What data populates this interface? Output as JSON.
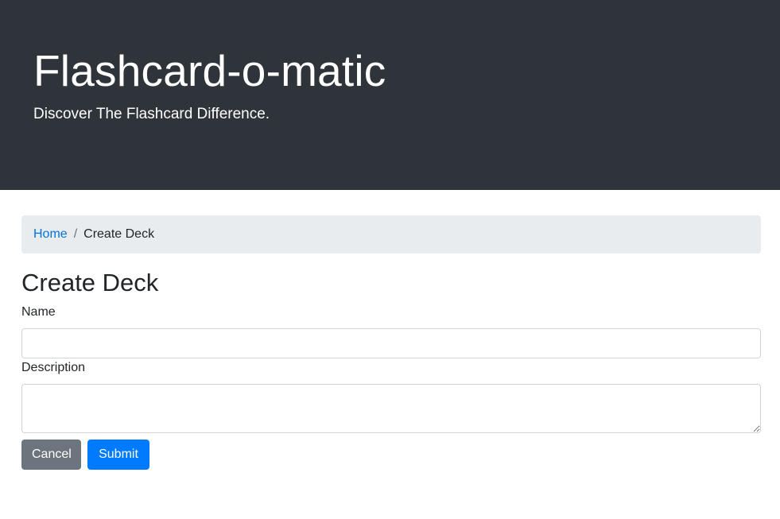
{
  "header": {
    "title": "Flashcard-o-matic",
    "tagline": "Discover The Flashcard Difference."
  },
  "breadcrumb": {
    "home_label": "Home",
    "separator": "/",
    "current_label": "Create Deck"
  },
  "form": {
    "title": "Create Deck",
    "name_label": "Name",
    "name_value": "",
    "name_placeholder": "",
    "description_label": "Description",
    "description_value": "",
    "description_placeholder": "",
    "cancel_label": "Cancel",
    "submit_label": "Submit"
  },
  "colors": {
    "header_bg": "#2f333a",
    "breadcrumb_bg": "#e9ecef",
    "link": "#0074d9",
    "cancel_bg": "#6c757d",
    "submit_bg": "#007bff"
  }
}
